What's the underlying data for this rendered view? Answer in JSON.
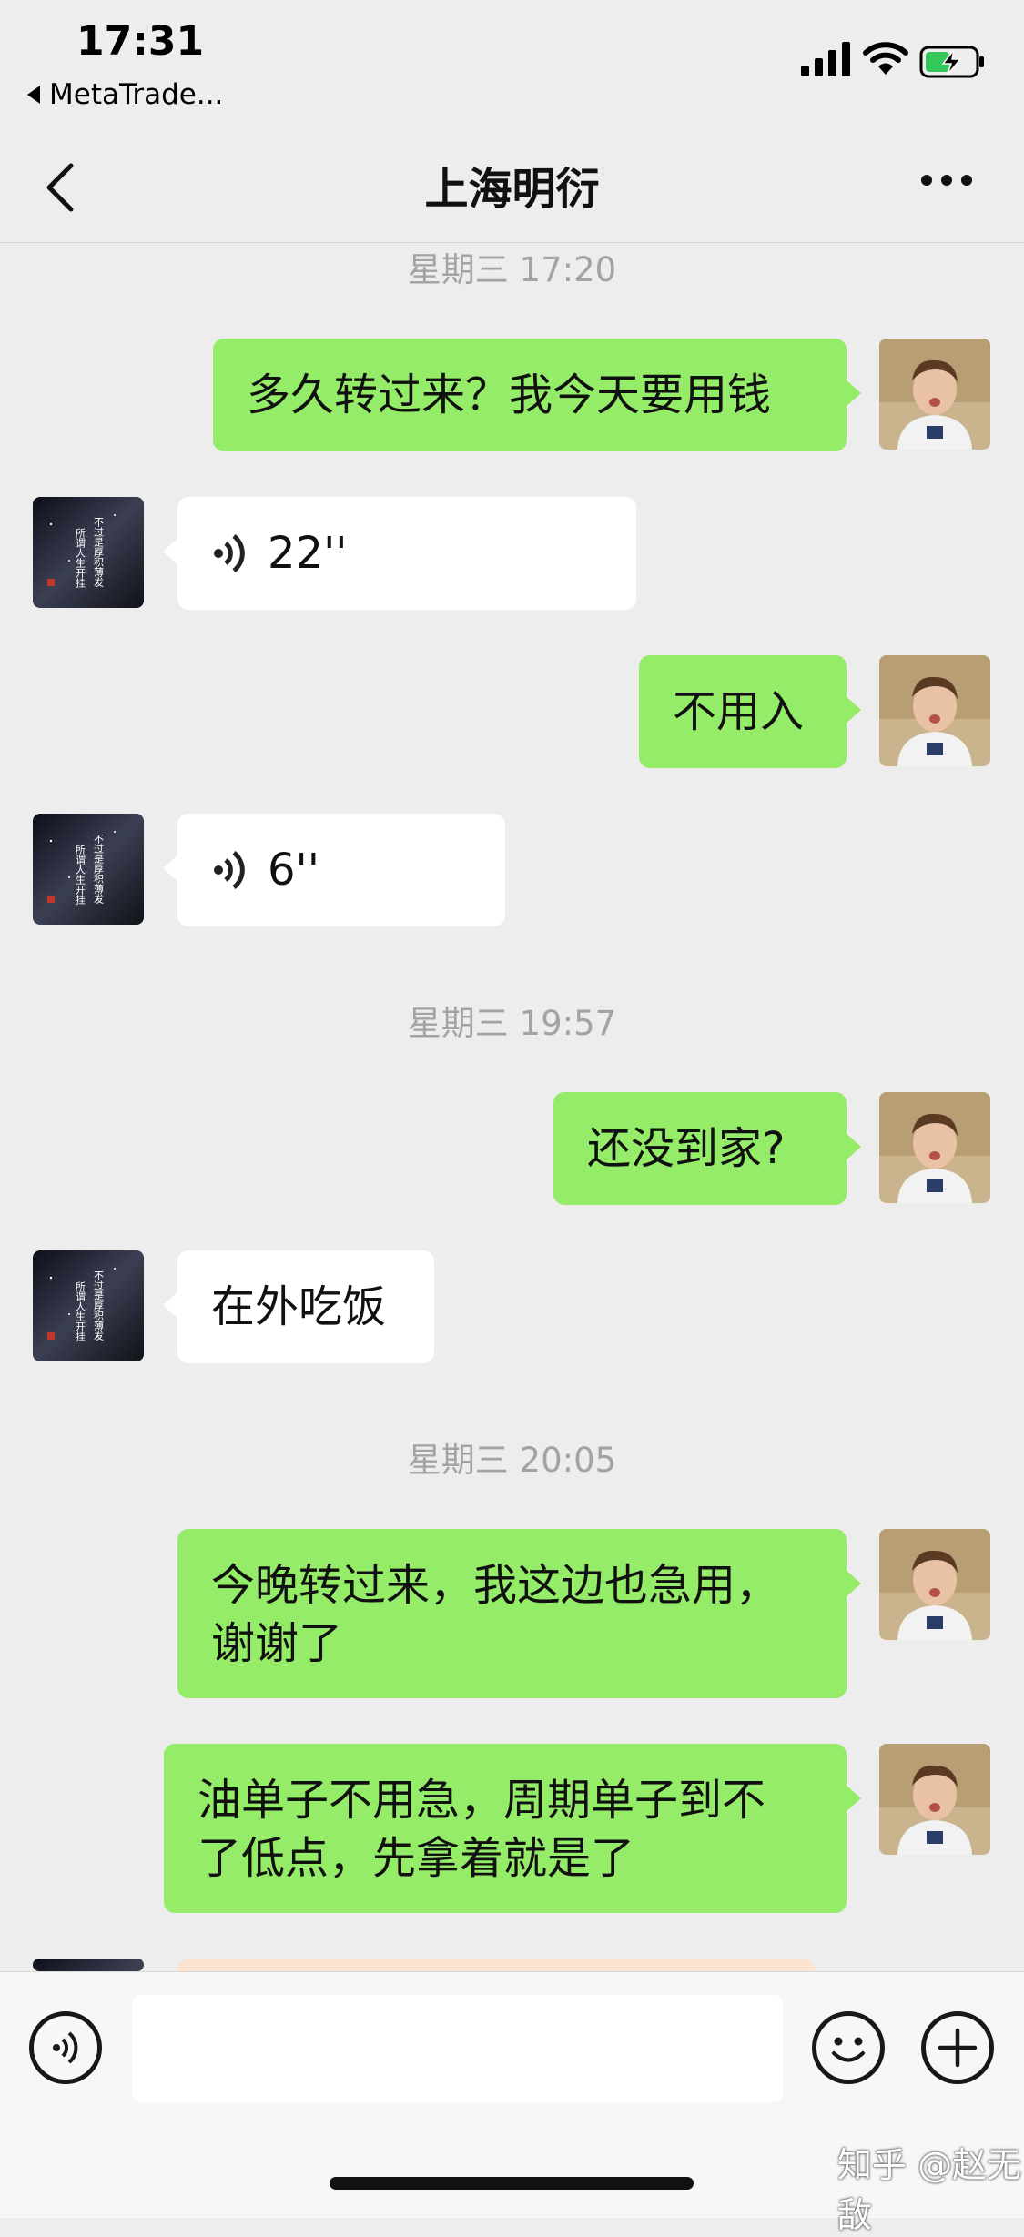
{
  "status_bar": {
    "time": "17:31",
    "back_app_label": "MetaTrade...",
    "icons": [
      "cellular-signal-icon",
      "wifi-icon",
      "battery-charging-icon"
    ]
  },
  "nav": {
    "title": "上海明衍",
    "icons": [
      "back-chevron-icon",
      "more-dots-icon"
    ]
  },
  "messages": {
    "sep1": "星期三 17:20",
    "m1": "多久转过来？我今天要用钱",
    "m2_duration": "22''",
    "m3": "不用入",
    "m4_duration": "6''",
    "sep2": "星期三 19:57",
    "m5": "还没到家?",
    "m6": "在外吃饭",
    "sep3": "星期三 20:05",
    "m7_line1": "今晚转过来，我这边也急用，",
    "m7_line2": "谢谢了",
    "m8_line1": "油单子不用急，周期单子到不",
    "m8_line2": "了低点，先拿着就是了"
  },
  "contact_avatar": {
    "line_a": "不过是厚积薄发",
    "line_b": "所谓人生开挂"
  },
  "input_bar": {
    "icons": [
      "voice-input-icon",
      "emoji-icon",
      "plus-icon"
    ]
  },
  "watermark": "知乎 @赵无敌",
  "colors": {
    "background": "#ededed",
    "self_bubble": "#95ec69",
    "other_bubble": "#ffffff",
    "timestamp": "#a3a3a3"
  }
}
